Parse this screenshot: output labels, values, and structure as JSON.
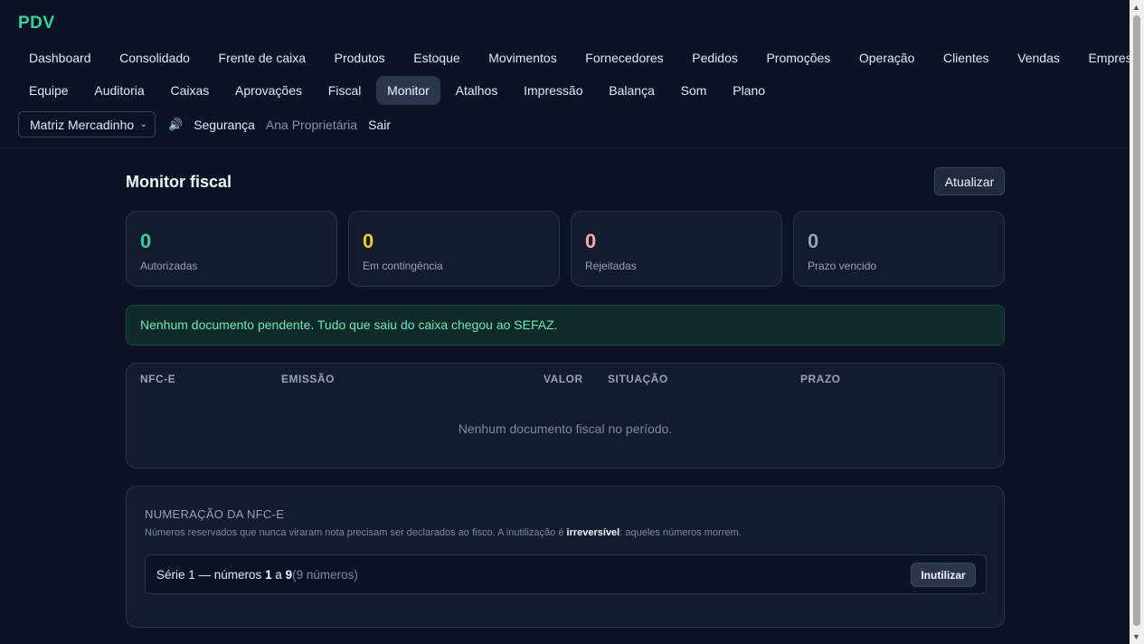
{
  "app": {
    "brand": "PDV"
  },
  "nav": {
    "row1": [
      "Dashboard",
      "Consolidado",
      "Frente de caixa",
      "Produtos",
      "Estoque",
      "Movimentos",
      "Fornecedores",
      "Pedidos",
      "Promoções",
      "Operação",
      "Clientes",
      "Vendas",
      "Empresas"
    ],
    "row2": [
      "Equipe",
      "Auditoria",
      "Caixas",
      "Aprovações",
      "Fiscal",
      "Monitor",
      "Atalhos",
      "Impressão",
      "Balança",
      "Som",
      "Plano"
    ],
    "active": "Monitor"
  },
  "controls": {
    "store_selected": "Matriz Mercadinho",
    "security": "Segurança",
    "user": "Ana Proprietária",
    "logout": "Sair"
  },
  "page": {
    "title": "Monitor fiscal",
    "refresh": "Atualizar"
  },
  "stats": [
    {
      "value": "0",
      "label": "Autorizadas",
      "color": "#34d399"
    },
    {
      "value": "0",
      "label": "Em contingência",
      "color": "#facc15"
    },
    {
      "value": "0",
      "label": "Rejeitadas",
      "color": "#f9a8b4"
    },
    {
      "value": "0",
      "label": "Prazo vencido",
      "color": "#94a3b8"
    }
  ],
  "notice": "Nenhum documento pendente. Tudo que saiu do caixa chegou ao SEFAZ.",
  "table": {
    "headers": [
      "NFC-E",
      "EMISSÃO",
      "VALOR",
      "SITUAÇÃO",
      "PRAZO"
    ],
    "empty": "Nenhum documento fiscal no período."
  },
  "numbering": {
    "title": "NUMERAÇÃO DA NFC-E",
    "desc_pre": "Números reservados que nunca viraram nota precisam ser declarados ao fisco. A inutilização é ",
    "desc_bold": "irreversível",
    "desc_post": ": aqueles números morrem.",
    "series_pre": "Série 1 — números ",
    "range_start": "1",
    "range_mid": " a ",
    "range_end": "9",
    "count": "(9 números)",
    "button": "Inutilizar"
  }
}
